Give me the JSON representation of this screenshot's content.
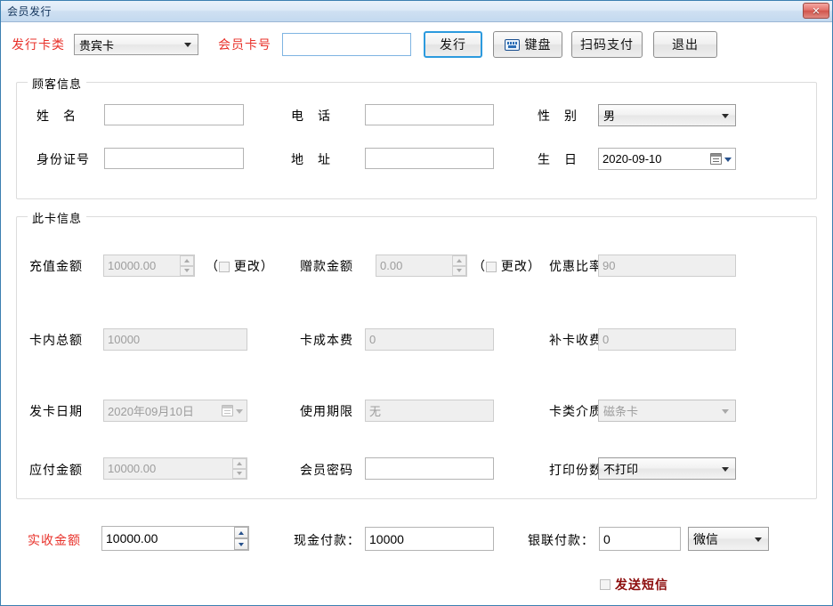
{
  "window": {
    "title": "会员发行",
    "close_label": "✕"
  },
  "toolbar": {
    "card_type_label": "发行卡类",
    "card_type_value": "贵宾卡",
    "card_no_label": "会员卡号",
    "card_no_value": "",
    "issue_button": "发行",
    "keyboard_button": "键盘",
    "scan_pay_button": "扫码支付",
    "exit_button": "退出"
  },
  "customer": {
    "group_title": "顾客信息",
    "name_label": "姓　名",
    "name_value": "",
    "phone_label": "电　话",
    "phone_value": "",
    "gender_label": "性　别",
    "gender_value": "男",
    "id_label": "身份证号",
    "id_value": "",
    "address_label": "地　址",
    "address_value": "",
    "birthday_label": "生　日",
    "birthday_value": "2020-09-10"
  },
  "card": {
    "group_title": "此卡信息",
    "recharge_label": "充值金额",
    "recharge_value": "10000.00",
    "recharge_change_prefix": "（",
    "recharge_change_label": "更改",
    "recharge_change_suffix": "）",
    "gift_label": "赠款金额",
    "gift_value": "0.00",
    "gift_change_prefix": "（",
    "gift_change_label": "更改",
    "gift_change_suffix": "）",
    "discount_label": "优惠比率",
    "discount_value": "90",
    "total_label": "卡内总额",
    "total_value": "10000",
    "cost_label": "卡成本费",
    "cost_value": "0",
    "reissue_label": "补卡收费",
    "reissue_value": "0",
    "issue_date_label": "发卡日期",
    "issue_date_value": "2020年09月10日",
    "validity_label": "使用期限",
    "validity_value": "无",
    "medium_label": "卡类介质",
    "medium_value": "磁条卡",
    "payable_label": "应付金额",
    "payable_value": "10000.00",
    "password_label": "会员密码",
    "password_value": "",
    "print_label": "打印份数",
    "print_value": "不打印"
  },
  "payment": {
    "received_label": "实收金额",
    "received_value": "10000.00",
    "cash_label": "现金付款：",
    "cash_value": "10000",
    "unionpay_label": "银联付款：",
    "unionpay_value": "0",
    "channel_value": "微信",
    "sms_label": "发送短信"
  },
  "colors": {
    "accent_red": "#e8312a",
    "sms_red": "#8b0a0a",
    "focus_blue": "#2c9ade"
  }
}
